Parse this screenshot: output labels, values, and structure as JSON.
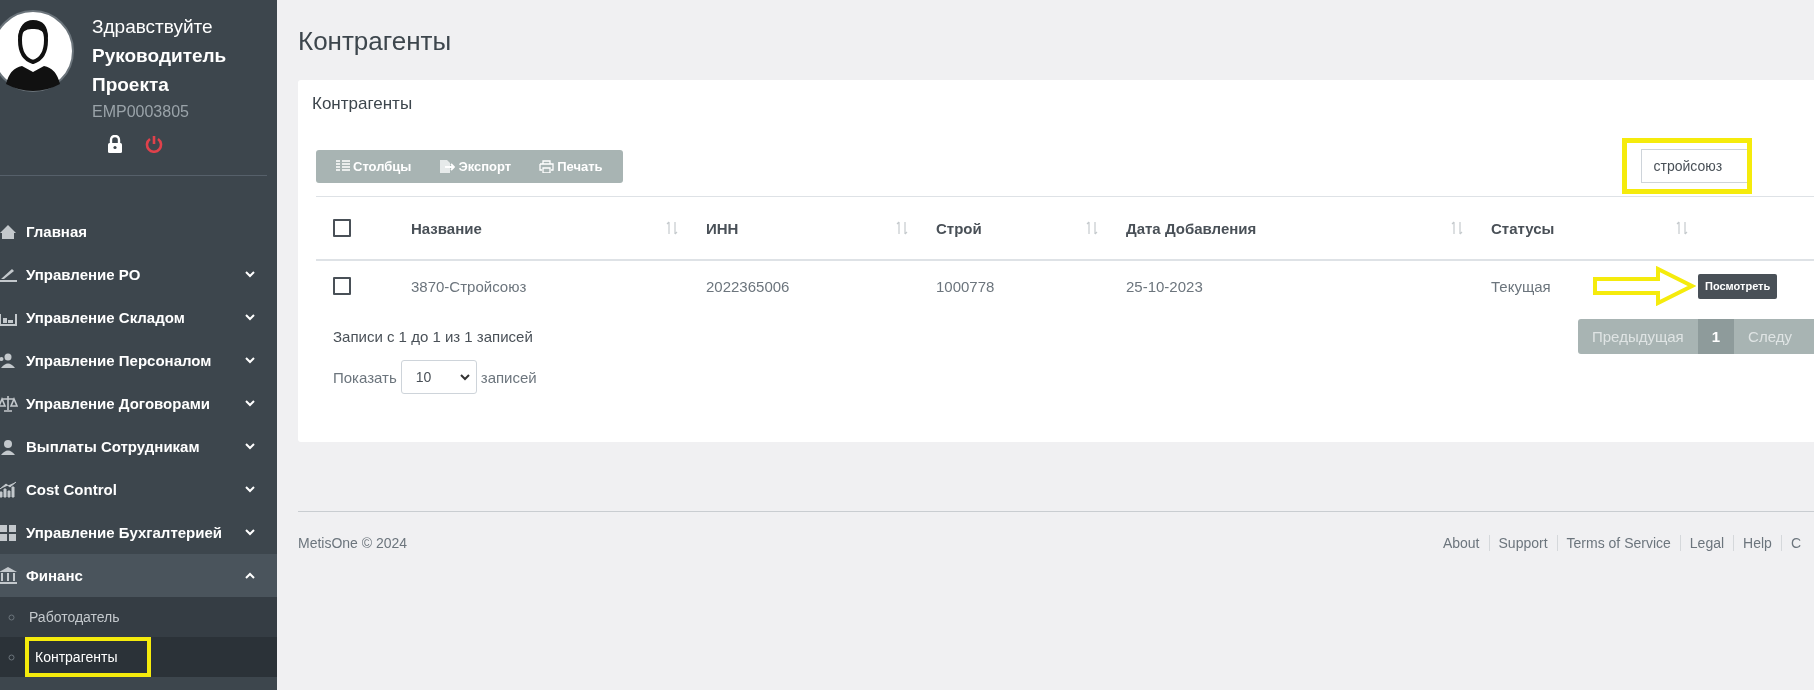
{
  "user": {
    "greeting": "Здравствуйте",
    "name": "Руководитель Проекта",
    "employee_id": "EMP0003805"
  },
  "sidebar": {
    "items": [
      {
        "label": "Главная",
        "kind": "link",
        "selected": false
      },
      {
        "label": "Управление PO",
        "kind": "group",
        "expanded": false,
        "selected": false
      },
      {
        "label": "Управление Складом",
        "kind": "group",
        "expanded": false,
        "selected": false
      },
      {
        "label": "Управление Персоналом",
        "kind": "group",
        "expanded": false,
        "selected": false
      },
      {
        "label": "Управление Договорами",
        "kind": "group",
        "expanded": false,
        "selected": false
      },
      {
        "label": "Выплаты Сотрудникам",
        "kind": "group",
        "expanded": false,
        "selected": false
      },
      {
        "label": "Cost Control",
        "kind": "group",
        "expanded": false,
        "selected": false
      },
      {
        "label": "Управление Бухгалтерией",
        "kind": "group",
        "expanded": false,
        "selected": false
      },
      {
        "label": "Финанс",
        "kind": "group",
        "expanded": true,
        "selected": true,
        "children": [
          {
            "label": "Работодатель",
            "selected": false,
            "highlighted": false
          },
          {
            "label": "Контрагенты",
            "selected": true,
            "highlighted": true
          }
        ]
      }
    ]
  },
  "page_title": "Контрагенты",
  "card": {
    "title": "Контрагенты",
    "toolbar": [
      "Столбцы",
      "Экспорт",
      "Печать"
    ],
    "search": {
      "value": "стройсоюз",
      "highlighted": true
    },
    "table": {
      "columns": [
        "Название",
        "ИНН",
        "Строй",
        "Дата Добавления",
        "Статусы"
      ],
      "header_checked": false,
      "rows": [
        {
          "checked": false,
          "cells": [
            "3870-Стройсоюз",
            "2022365006",
            "1000778",
            "25-10-2023",
            "Текущая"
          ],
          "action": "Посмотреть",
          "highlighted": true
        }
      ]
    },
    "info": "Записи с 1 до 1 из 1 записей",
    "show_label": "Показать",
    "page_size": "10",
    "show_suffix": "записей",
    "pagination": [
      {
        "label": "Предыдущая",
        "selected": false
      },
      {
        "label": "1",
        "selected": true
      },
      {
        "label": "Следу",
        "selected": false
      }
    ]
  },
  "footer": {
    "copyright": "MetisOne © 2024",
    "links": [
      "About",
      "Support",
      "Terms of Service",
      "Legal",
      "Help",
      "C"
    ]
  }
}
